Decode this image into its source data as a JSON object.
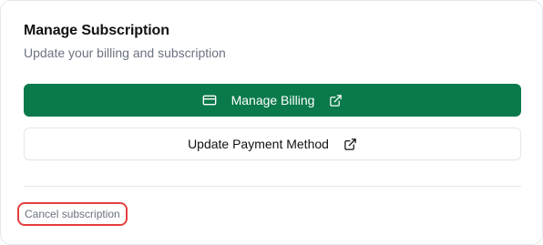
{
  "card": {
    "title": "Manage Subscription",
    "subtitle": "Update your billing and subscription"
  },
  "buttons": {
    "manage_billing": {
      "label": "Manage Billing",
      "lead_icon": "credit-card-icon",
      "trail_icon": "external-link-icon"
    },
    "update_payment": {
      "label": "Update Payment Method",
      "trail_icon": "external-link-icon"
    }
  },
  "footer": {
    "cancel_label": "Cancel subscription"
  },
  "colors": {
    "primary": "#0a7a4b",
    "highlight_border": "#e53e3e",
    "muted_text": "#6b7280"
  }
}
